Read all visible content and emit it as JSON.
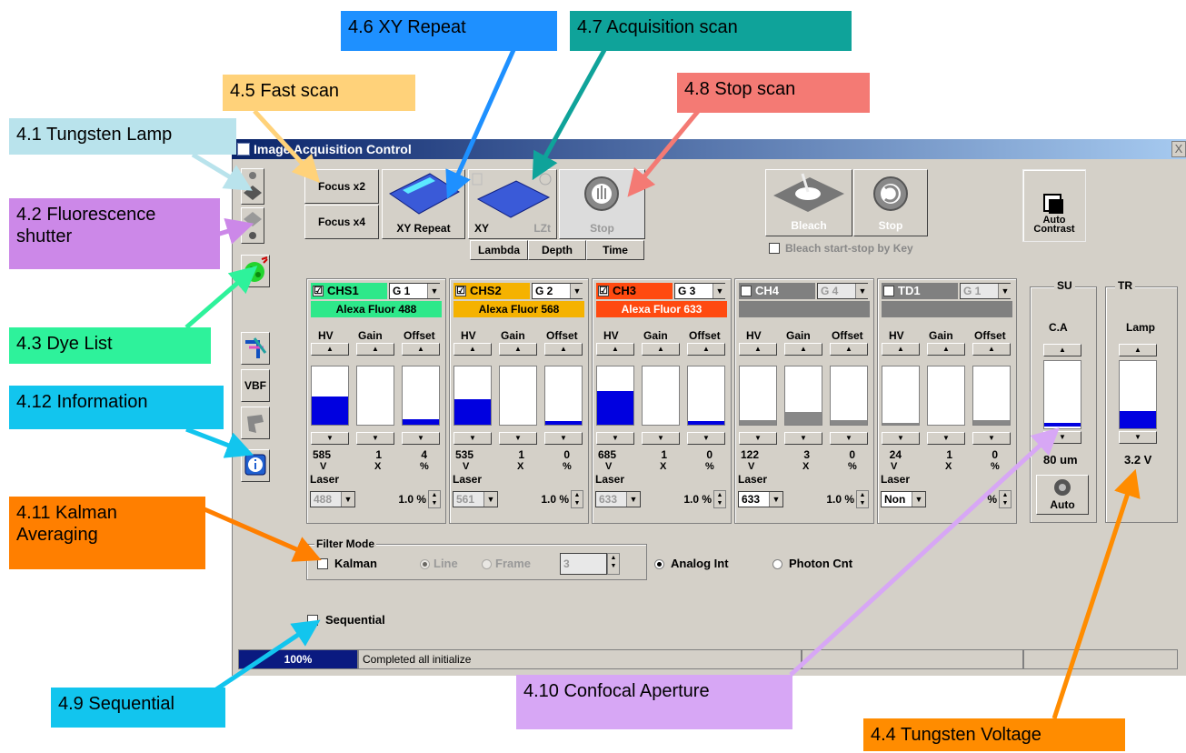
{
  "window": {
    "title": "Image Acquisition Control",
    "close": "X"
  },
  "callouts": {
    "c41": "4.1 Tungsten Lamp",
    "c42": "4.2 Fluorescence shutter",
    "c43": "4.3 Dye List",
    "c44": "4.4 Tungsten Voltage",
    "c45": "4.5 Fast scan",
    "c46": "4.6 XY Repeat",
    "c47": "4.7 Acquisition scan",
    "c48": "4.8 Stop scan",
    "c49": "4.9 Sequential",
    "c410": "4.10 Confocal Aperture",
    "c411": "4.11 Kalman Averaging",
    "c412": "4.12 Information"
  },
  "colors": {
    "c41": "#b9e3ec",
    "c42": "#cc88e8",
    "c43": "#2ef29b",
    "c44": "#ff8c00",
    "c45": "#ffd27a",
    "c46": "#1e90ff",
    "c47": "#0fa39a",
    "c48": "#f47a74",
    "c49": "#12c5ee",
    "c410": "#d7a7f5",
    "c411": "#ff7f00",
    "c412": "#12c5ee"
  },
  "left_tools": {
    "vbf": "VBF"
  },
  "scan": {
    "focus2": "Focus x2",
    "focus4": "Focus x4",
    "xy_repeat": "XY Repeat",
    "xy": "XY",
    "lzt": "LZt",
    "stop": "Stop",
    "lambda": "Lambda",
    "depth": "Depth",
    "time": "Time"
  },
  "bleach": {
    "bleach": "Bleach",
    "stop": "Stop",
    "key_label": "Bleach start-stop by Key"
  },
  "auto_contrast": "Auto Contrast",
  "col_labels": {
    "hv": "HV",
    "gain": "Gain",
    "offset": "Offset",
    "laser": "Laser"
  },
  "channels": [
    {
      "name": "CHS1",
      "checked": "☑",
      "group": "G 1",
      "dye": "Alexa Fluor 488",
      "color": "#2ee88a",
      "dye_color": "#2ee88a",
      "hv": "585",
      "gain": "1",
      "offset": "4",
      "hv_u": "V",
      "gain_u": "X",
      "offset_u": "%",
      "laser": "488",
      "pct": "1.0 %",
      "hv_level": 0.48,
      "gain_level": 0.0,
      "offset_level": 0.1
    },
    {
      "name": "CHS2",
      "checked": "☑",
      "group": "G 2",
      "dye": "Alexa Fluor 568",
      "color": "#f5b200",
      "dye_color": "#f5b200",
      "hv": "535",
      "gain": "1",
      "offset": "0",
      "hv_u": "V",
      "gain_u": "X",
      "offset_u": "%",
      "laser": "561",
      "pct": "1.0 %",
      "hv_level": 0.44,
      "gain_level": 0.0,
      "offset_level": 0.07
    },
    {
      "name": "CH3",
      "checked": "☑",
      "group": "G 3",
      "dye": "Alexa Fluor 633",
      "color": "#ff4a10",
      "dye_color": "#ff4a10",
      "hv": "685",
      "gain": "1",
      "offset": "0",
      "hv_u": "V",
      "gain_u": "X",
      "offset_u": "%",
      "laser": "633",
      "pct": "1.0 %",
      "hv_level": 0.58,
      "gain_level": 0.0,
      "offset_level": 0.07
    },
    {
      "name": "CH4",
      "checked": "",
      "group": "G 4",
      "dye": "",
      "color": "#808080",
      "dye_color": "#808080",
      "hv": "122",
      "gain": "3",
      "offset": "0",
      "hv_u": "V",
      "gain_u": "X",
      "offset_u": "%",
      "laser": "633",
      "pct": "1.0 %",
      "hv_level": 0.08,
      "gain_level": 0.22,
      "offset_level": 0.08
    },
    {
      "name": "TD1",
      "checked": "",
      "group": "G 1",
      "dye": "",
      "color": "#808080",
      "dye_color": "#808080",
      "hv": "24",
      "gain": "1",
      "offset": "0",
      "hv_u": "V",
      "gain_u": "X",
      "offset_u": "%",
      "laser": "Non",
      "pct": "%",
      "hv_level": 0.03,
      "gain_level": 0.0,
      "offset_level": 0.08
    }
  ],
  "su": {
    "title": "SU",
    "ca": "C.A",
    "value": "80 um",
    "auto": "Auto",
    "level": 0.05
  },
  "tr": {
    "title": "TR",
    "lamp": "Lamp",
    "value": "3.2 V",
    "level": 0.26
  },
  "filter": {
    "title": "Filter Mode",
    "kalman": "Kalman",
    "line": "Line",
    "frame": "Frame",
    "count": "3",
    "analog": "Analog Int",
    "photon": "Photon Cnt"
  },
  "sequential": "Sequential",
  "status": {
    "progress": "100%",
    "progress_level": 1.0,
    "message": "Completed all initialize"
  }
}
